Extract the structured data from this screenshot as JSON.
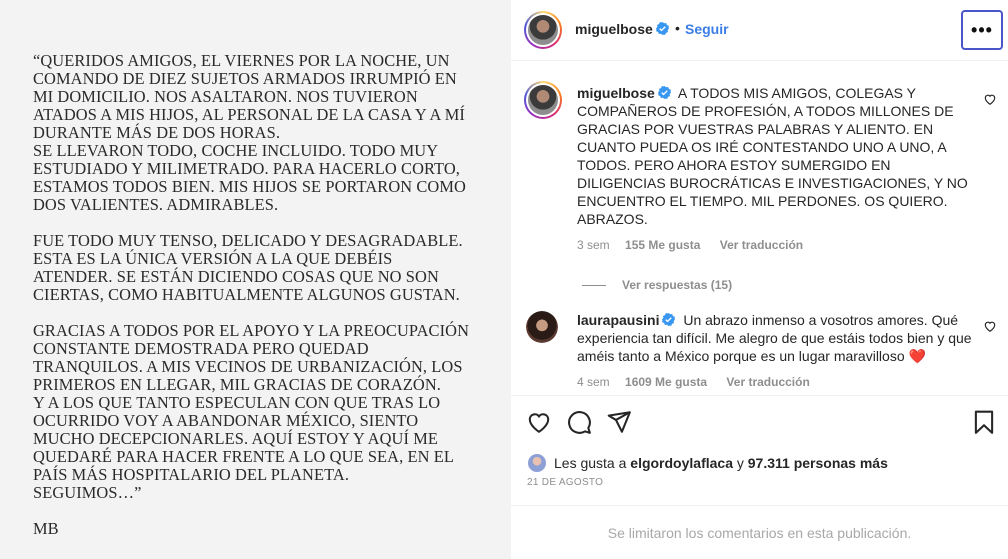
{
  "post_image": {
    "paragraphs": [
      "“QUERIDOS AMIGOS, EL VIERNES POR LA NOCHE, UN\nCOMANDO DE DIEZ SUJETOS ARMADOS IRRUMPIÓ EN\nMI DOMICILIO. NOS ASALTARON. NOS TUVIERON\nATADOS A MIS HIJOS, AL PERSONAL DE LA CASA Y A MÍ\nDURANTE MÁS DE DOS HORAS.\nSE LLEVARON TODO, COCHE INCLUIDO. TODO MUY\nESTUDIADO Y MILIMETRADO. PARA HACERLO CORTO,\nESTAMOS TODOS BIEN. MIS HIJOS SE PORTARON COMO\nDOS VALIENTES. ADMIRABLES.",
      "FUE TODO MUY TENSO, DELICADO Y DESAGRADABLE.\nESTA ES LA ÚNICA VERSIÓN A LA QUE DEBÉIS\nATENDER. SE ESTÁN DICIENDO COSAS QUE NO SON\nCIERTAS, COMO HABITUALMENTE ALGUNOS GUSTAN.",
      "GRACIAS A TODOS POR EL APOYO Y LA PREOCUPACIÓN\nCONSTANTE DEMOSTRADA PERO QUEDAD\nTRANQUILOS. A MIS VECINOS DE URBANIZACIÓN, LOS\nPRIMEROS EN LLEGAR, MIL GRACIAS DE CORAZÓN.\nY A LOS QUE TANTO ESPECULAN CON QUE TRAS LO\nOCURRIDO VOY A ABANDONAR MÉXICO, SIENTO\nMUCHO DECEPCIONARLES. AQUÍ ESTOY Y AQUÍ ME\nQUEDARÉ PARA HACER FRENTE A LO QUE SEA, EN EL\nPAÍS MÁS HOSPITALARIO DEL PLANETA.\nSEGUIMOS…”",
      "MB"
    ]
  },
  "header": {
    "username": "miguelbose",
    "separator": "•",
    "follow_label": "Seguir",
    "more_label": "•••"
  },
  "comments": [
    {
      "username": "miguelbose",
      "text": "A TODOS MIS AMIGOS, COLEGAS Y COMPAÑEROS DE PROFESIÓN, A TODOS MILLONES DE GRACIAS POR VUESTRAS PALABRAS Y ALIENTO. EN CUANTO PUEDA OS IRÉ CONTESTANDO UNO A UNO, A TODOS. PERO AHORA ESTOY SUMERGIDO EN DILIGENCIAS BUROCRÁTICAS E INVESTIGACIONES, Y NO ENCUENTRO EL TIEMPO. MIL PERDONES. OS QUIERO. ABRAZOS.",
      "time": "3 sem",
      "likes": "155 Me gusta",
      "translate": "Ver traducción",
      "replies": "Ver respuestas (15)"
    },
    {
      "username": "laurapausini",
      "text": "Un abrazo inmenso a vosotros amores. Qué experiencia tan difícil. Me alegro de que estáis todos bien y que améis tanto a México porque es un lugar maravilloso ❤️",
      "time": "4 sem",
      "likes": "1609 Me gusta",
      "translate": "Ver traducción"
    }
  ],
  "likes_bar": {
    "prefix": "Les gusta a",
    "user": "elgordoylaflaca",
    "conj": "y",
    "others": "97.311 personas más",
    "date": "21 DE AGOSTO"
  },
  "footer": {
    "limited_text": "Se limitaron los comentarios en esta publicación."
  },
  "colors": {
    "accent": "#3a7ee6",
    "verified": "#3897f0",
    "muted": "#8e8e8e"
  }
}
